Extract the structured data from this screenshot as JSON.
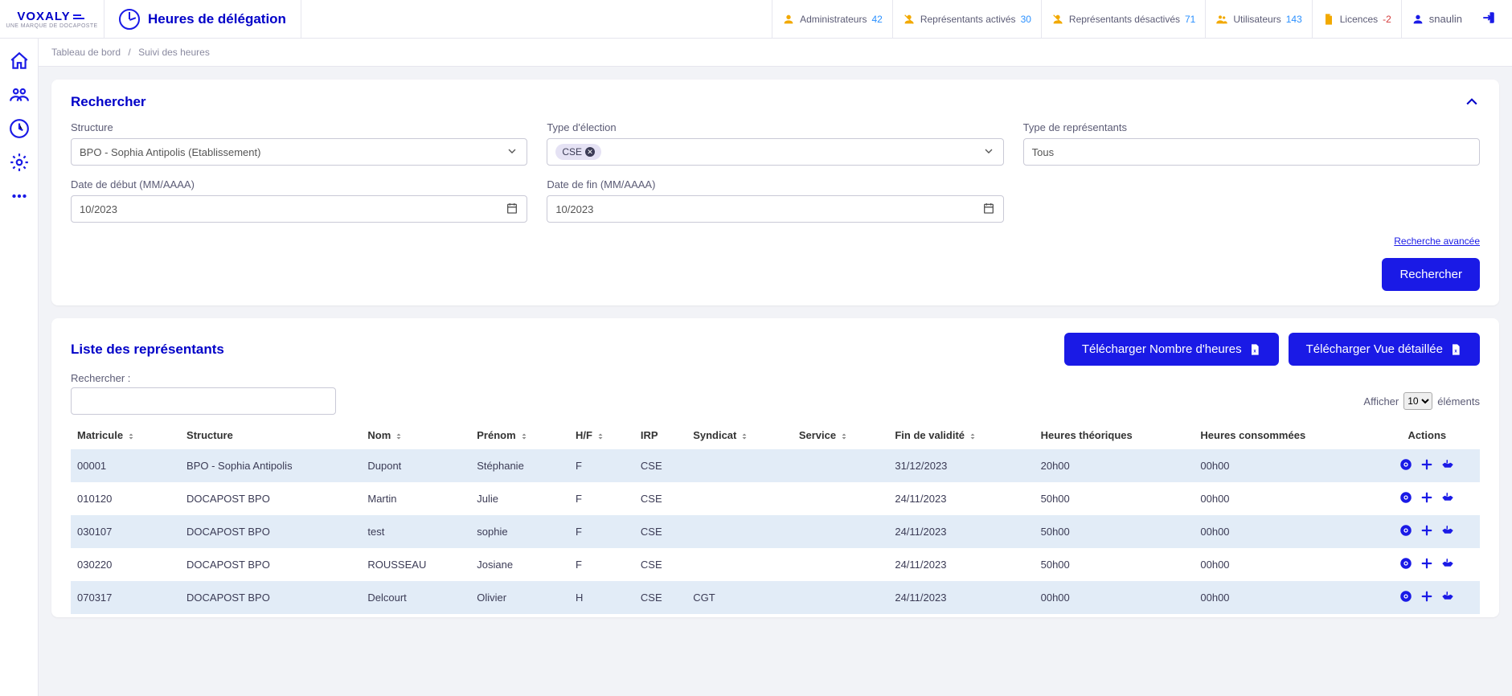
{
  "brand": {
    "name": "VOXALY",
    "tagline": "UNE MARQUE DE DOCAPOSTE"
  },
  "pageTitle": "Heures de délégation",
  "topStats": [
    {
      "icon": "user",
      "label": "Administrateurs",
      "count": "42"
    },
    {
      "icon": "user-off",
      "label": "Représentants activés",
      "count": "30"
    },
    {
      "icon": "user-off",
      "label": "Représentants désactivés",
      "count": "71"
    },
    {
      "icon": "users",
      "label": "Utilisateurs",
      "count": "143"
    },
    {
      "icon": "file",
      "label": "Licences",
      "count": "-2",
      "neg": true
    }
  ],
  "user": {
    "name": "snaulin"
  },
  "breadcrumbs": {
    "root": "Tableau de bord",
    "current": "Suivi des heures"
  },
  "search": {
    "title": "Rechercher",
    "fields": {
      "structure": {
        "label": "Structure",
        "value": "BPO - Sophia Antipolis (Etablissement)"
      },
      "election": {
        "label": "Type d'élection",
        "tag": "CSE"
      },
      "repType": {
        "label": "Type de représentants",
        "value": "Tous"
      },
      "dateStart": {
        "label": "Date de début (MM/AAAA)",
        "value": "10/2023"
      },
      "dateEnd": {
        "label": "Date de fin (MM/AAAA)",
        "value": "10/2023"
      }
    },
    "advanced": "Recherche avancée",
    "button": "Rechercher"
  },
  "list": {
    "title": "Liste des représentants",
    "dlHours": "Télécharger Nombre d'heures",
    "dlDetail": "Télécharger Vue détaillée",
    "searchLabel": "Rechercher :",
    "showLabel": "Afficher",
    "showSuffix": "éléments",
    "pageSize": "10",
    "columns": {
      "matricule": "Matricule",
      "structure": "Structure",
      "nom": "Nom",
      "prenom": "Prénom",
      "hf": "H/F",
      "irp": "IRP",
      "syndicat": "Syndicat",
      "service": "Service",
      "fin": "Fin de validité",
      "theor": "Heures théoriques",
      "conso": "Heures consommées",
      "actions": "Actions"
    },
    "rows": [
      {
        "matricule": "00001",
        "structure": "BPO - Sophia Antipolis",
        "nom": "Dupont",
        "prenom": "Stéphanie",
        "hf": "F",
        "irp": "CSE",
        "syndicat": "",
        "service": "",
        "fin": "31/12/2023",
        "theor": "20h00",
        "conso": "00h00"
      },
      {
        "matricule": "010120",
        "structure": "DOCAPOST BPO",
        "nom": "Martin",
        "prenom": "Julie",
        "hf": "F",
        "irp": "CSE",
        "syndicat": "",
        "service": "",
        "fin": "24/11/2023",
        "theor": "50h00",
        "conso": "00h00"
      },
      {
        "matricule": "030107",
        "structure": "DOCAPOST BPO",
        "nom": "test",
        "prenom": "sophie",
        "hf": "F",
        "irp": "CSE",
        "syndicat": "",
        "service": "",
        "fin": "24/11/2023",
        "theor": "50h00",
        "conso": "00h00"
      },
      {
        "matricule": "030220",
        "structure": "DOCAPOST BPO",
        "nom": "ROUSSEAU",
        "prenom": "Josiane",
        "hf": "F",
        "irp": "CSE",
        "syndicat": "",
        "service": "",
        "fin": "24/11/2023",
        "theor": "50h00",
        "conso": "00h00"
      },
      {
        "matricule": "070317",
        "structure": "DOCAPOST BPO",
        "nom": "Delcourt",
        "prenom": "Olivier",
        "hf": "H",
        "irp": "CSE",
        "syndicat": "CGT",
        "service": "",
        "fin": "24/11/2023",
        "theor": "00h00",
        "conso": "00h00"
      }
    ]
  }
}
